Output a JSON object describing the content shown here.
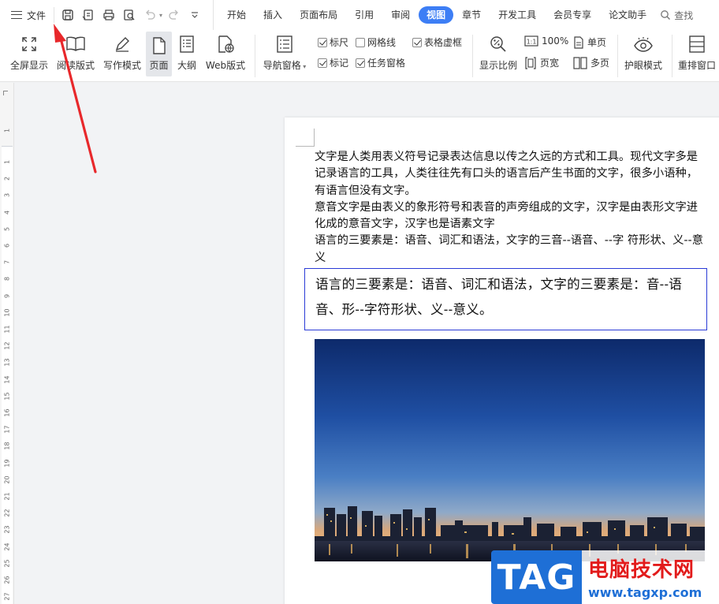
{
  "menubar": {
    "file_label": "文件",
    "tabs": [
      {
        "label": "开始"
      },
      {
        "label": "插入"
      },
      {
        "label": "页面布局"
      },
      {
        "label": "引用"
      },
      {
        "label": "审阅"
      },
      {
        "label": "视图",
        "active": true
      },
      {
        "label": "章节"
      },
      {
        "label": "开发工具"
      },
      {
        "label": "会员专享"
      },
      {
        "label": "论文助手"
      }
    ],
    "search_label": "查找"
  },
  "ribbon": {
    "fullscreen": "全屏显示",
    "reading": "阅读版式",
    "writing": "写作模式",
    "page": "页面",
    "outline": "大纲",
    "web": "Web版式",
    "nav_pane": "导航窗格",
    "checks": [
      {
        "label": "标尺",
        "checked": true
      },
      {
        "label": "网格线",
        "checked": false
      },
      {
        "label": "表格虚框",
        "checked": true
      },
      {
        "label": "标记",
        "checked": true
      },
      {
        "label": "任务窗格",
        "checked": true
      }
    ],
    "zoom_label": "显示比例",
    "zoom_100": "100%",
    "page_width": "页宽",
    "single_page": "单页",
    "multi_page": "多页",
    "eye_mode": "护眼模式",
    "rearrange": "重排窗口"
  },
  "ruler": {
    "ticks": [
      "1",
      "1",
      "2",
      "3",
      "4",
      "5",
      "6",
      "7",
      "8",
      "9",
      "10",
      "11",
      "12",
      "13",
      "14",
      "15",
      "16",
      "17",
      "18",
      "19",
      "20",
      "21",
      "22",
      "23",
      "24",
      "25",
      "26",
      "27"
    ]
  },
  "document": {
    "paragraphs": [
      "文字是人类用表义符号记录表达信息以传之久远的方式和工具。现代文字多是记录语言的工具，人类往往先有口头的语言后产生书面的文字，很多小语种，有语言但没有文字。",
      "意音文字是由表义的象形符号和表音的声旁组成的文字，汉字是由表形文字进化成的意音文字，汉字也是语素文字",
      "语言的三要素是：语音、词汇和语法，文字的三音--语音、--字 符形状、义--意义"
    ],
    "framed_text": "语言的三要素是：语音、词汇和语法，文字的三要素是：音--语音、形--字符形状、义--意义。"
  },
  "watermark": {
    "tag": "TAG",
    "site_name": "电脑技术网",
    "url": "www.tagxp.com"
  },
  "colors": {
    "accent": "#3d7ef5",
    "frame": "#2a3bd6",
    "arrow": "#e8282b",
    "watermark_blue": "#1e6fd6",
    "watermark_red": "#e21b1b"
  }
}
